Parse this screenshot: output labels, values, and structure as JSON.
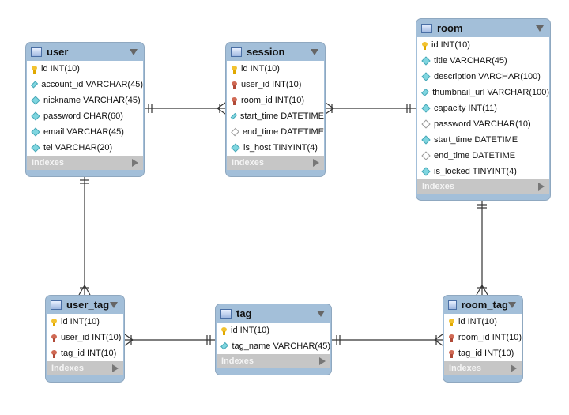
{
  "tables": {
    "user": {
      "name": "user",
      "indexes_label": "Indexes",
      "columns": [
        {
          "text": "id INT(10)",
          "icon": "primary-key"
        },
        {
          "text": "account_id VARCHAR(45)",
          "icon": "diamond-filled"
        },
        {
          "text": "nickname VARCHAR(45)",
          "icon": "diamond-filled"
        },
        {
          "text": "password CHAR(60)",
          "icon": "diamond-filled"
        },
        {
          "text": "email VARCHAR(45)",
          "icon": "diamond-filled"
        },
        {
          "text": "tel VARCHAR(20)",
          "icon": "diamond-filled"
        }
      ]
    },
    "session": {
      "name": "session",
      "indexes_label": "Indexes",
      "columns": [
        {
          "text": "id INT(10)",
          "icon": "primary-key"
        },
        {
          "text": "user_id INT(10)",
          "icon": "foreign-key"
        },
        {
          "text": "room_id INT(10)",
          "icon": "foreign-key"
        },
        {
          "text": "start_time DATETIME",
          "icon": "diamond-filled"
        },
        {
          "text": "end_time DATETIME",
          "icon": "diamond-hollow"
        },
        {
          "text": "is_host TINYINT(4)",
          "icon": "diamond-filled"
        }
      ]
    },
    "room": {
      "name": "room",
      "indexes_label": "Indexes",
      "columns": [
        {
          "text": "id INT(10)",
          "icon": "primary-key"
        },
        {
          "text": "title VARCHAR(45)",
          "icon": "diamond-filled"
        },
        {
          "text": "description VARCHAR(100)",
          "icon": "diamond-filled"
        },
        {
          "text": "thumbnail_url VARCHAR(100)",
          "icon": "diamond-filled"
        },
        {
          "text": "capacity INT(11)",
          "icon": "diamond-filled"
        },
        {
          "text": "password VARCHAR(10)",
          "icon": "diamond-hollow"
        },
        {
          "text": "start_time DATETIME",
          "icon": "diamond-filled"
        },
        {
          "text": "end_time DATETIME",
          "icon": "diamond-hollow"
        },
        {
          "text": "is_locked TINYINT(4)",
          "icon": "diamond-filled"
        }
      ]
    },
    "user_tag": {
      "name": "user_tag",
      "indexes_label": "Indexes",
      "columns": [
        {
          "text": "id INT(10)",
          "icon": "primary-key"
        },
        {
          "text": "user_id INT(10)",
          "icon": "foreign-key"
        },
        {
          "text": "tag_id INT(10)",
          "icon": "foreign-key"
        }
      ]
    },
    "tag": {
      "name": "tag",
      "indexes_label": "Indexes",
      "columns": [
        {
          "text": "id INT(10)",
          "icon": "primary-key"
        },
        {
          "text": "tag_name VARCHAR(45)",
          "icon": "diamond-filled"
        }
      ]
    },
    "room_tag": {
      "name": "room_tag",
      "indexes_label": "Indexes",
      "columns": [
        {
          "text": "id INT(10)",
          "icon": "primary-key"
        },
        {
          "text": "room_id INT(10)",
          "icon": "foreign-key"
        },
        {
          "text": "tag_id INT(10)",
          "icon": "foreign-key"
        }
      ]
    }
  },
  "relationships": [
    {
      "from": "user",
      "to": "session",
      "cardinality": "one-to-many"
    },
    {
      "from": "room",
      "to": "session",
      "cardinality": "one-to-many"
    },
    {
      "from": "user",
      "to": "user_tag",
      "cardinality": "one-to-many"
    },
    {
      "from": "tag",
      "to": "user_tag",
      "cardinality": "one-to-many"
    },
    {
      "from": "tag",
      "to": "room_tag",
      "cardinality": "one-to-many"
    },
    {
      "from": "room",
      "to": "room_tag",
      "cardinality": "one-to-many"
    }
  ]
}
